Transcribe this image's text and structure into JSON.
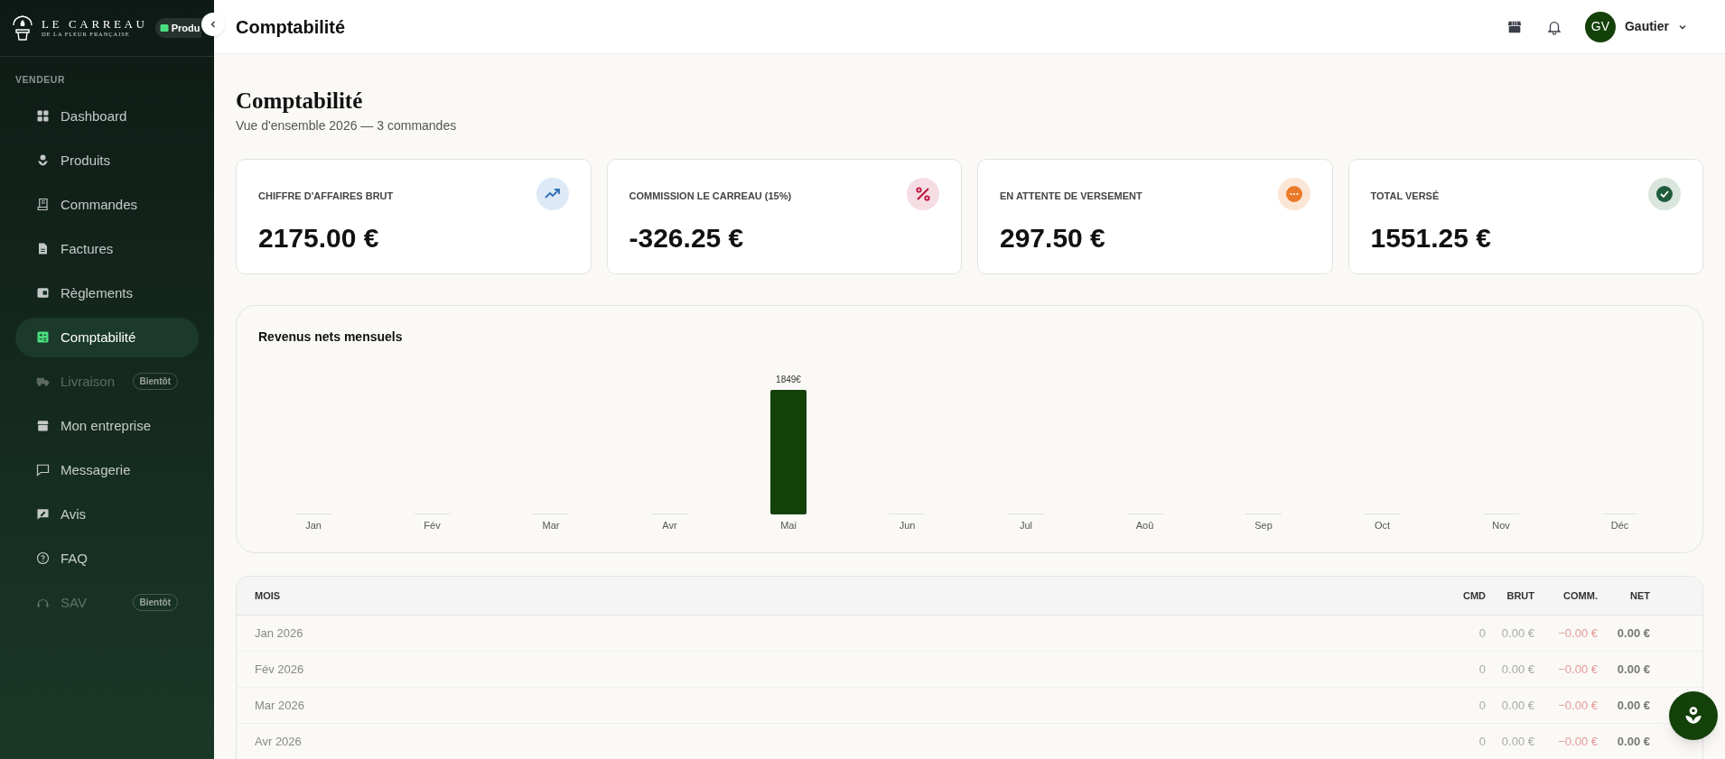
{
  "sidebar": {
    "logo": {
      "title": "LE CARREAU",
      "subtitle": "DE LA FLEUR FRANÇAISE",
      "badge": "Produ"
    },
    "section": "VENDEUR",
    "items": [
      {
        "kind": "dashboard",
        "label": "Dashboard",
        "selected": false,
        "disabled": false
      },
      {
        "kind": "products",
        "label": "Produits",
        "selected": false,
        "disabled": false
      },
      {
        "kind": "orders",
        "label": "Commandes",
        "selected": false,
        "disabled": false
      },
      {
        "kind": "invoices",
        "label": "Factures",
        "selected": false,
        "disabled": false
      },
      {
        "kind": "payments",
        "label": "Règlements",
        "selected": false,
        "disabled": false
      },
      {
        "kind": "accounting",
        "label": "Comptabilité",
        "selected": true,
        "disabled": false
      },
      {
        "kind": "delivery",
        "label": "Livraison",
        "selected": false,
        "disabled": true,
        "badge": "Bientôt"
      },
      {
        "kind": "company",
        "label": "Mon entreprise",
        "selected": false,
        "disabled": false
      },
      {
        "kind": "messages",
        "label": "Messagerie",
        "selected": false,
        "disabled": false
      },
      {
        "kind": "reviews",
        "label": "Avis",
        "selected": false,
        "disabled": false
      },
      {
        "kind": "faq",
        "label": "FAQ",
        "selected": false,
        "disabled": false
      },
      {
        "kind": "support",
        "label": "SAV",
        "selected": false,
        "disabled": true,
        "badge": "Bientôt"
      }
    ]
  },
  "header": {
    "title": "Comptabilité",
    "user": {
      "initials": "GV",
      "name": "Gautier"
    }
  },
  "page": {
    "title": "Comptabilité",
    "subtitle": "Vue d'ensemble 2026 — 3 commandes"
  },
  "kpis": [
    {
      "kind": "gross",
      "label": "CHIFFRE D'AFFAIRES BRUT",
      "value": "2175.00 €"
    },
    {
      "kind": "commission",
      "label": "COMMISSION LE CARREAU (15%)",
      "value": "-326.25 €"
    },
    {
      "kind": "pending",
      "label": "EN ATTENTE DE VERSEMENT",
      "value": "297.50 €"
    },
    {
      "kind": "paid",
      "label": "TOTAL VERSÉ",
      "value": "1551.25 €"
    }
  ],
  "chart": {
    "title": "Revenus nets mensuels",
    "chart_data": {
      "type": "bar",
      "categories": [
        "Jan",
        "Fév",
        "Mar",
        "Avr",
        "Mai",
        "Jun",
        "Jul",
        "Aoû",
        "Sep",
        "Oct",
        "Nov",
        "Déc"
      ],
      "values": [
        0,
        0,
        0,
        0,
        1849,
        0,
        0,
        0,
        0,
        0,
        0,
        0
      ],
      "value_labels": [
        null,
        null,
        null,
        null,
        "1849€",
        null,
        null,
        null,
        null,
        null,
        null,
        null
      ]
    }
  },
  "table": {
    "columns": [
      "MOIS",
      "CMD",
      "BRUT",
      "COMM.",
      "NET"
    ],
    "rows": [
      [
        "Jan 2026",
        "0",
        "0.00 €",
        "−0.00 €",
        "0.00 €"
      ],
      [
        "Fév 2026",
        "0",
        "0.00 €",
        "−0.00 €",
        "0.00 €"
      ],
      [
        "Mar 2026",
        "0",
        "0.00 €",
        "−0.00 €",
        "0.00 €"
      ],
      [
        "Avr 2026",
        "0",
        "0.00 €",
        "−0.00 €",
        "0.00 €"
      ]
    ]
  }
}
